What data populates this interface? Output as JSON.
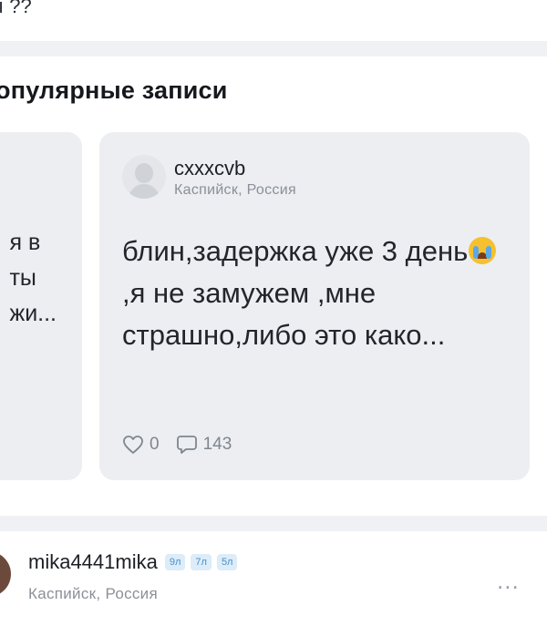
{
  "top_fragment": "ı ??",
  "section": {
    "title": "опулярные записи"
  },
  "left_card": {
    "lines": [
      "я в",
      "ты",
      "жи..."
    ]
  },
  "post": {
    "username": "cxxxcvb",
    "location": "Каспийск, Россия",
    "text_part1": "блин,задержка уже 3 день",
    "emoji": "loudly-crying-face",
    "text_part2": ",я не замужем ,мне страшно,либо это како...",
    "likes": "0",
    "comments": "143"
  },
  "next_post": {
    "username": "mika4441mika",
    "badges": [
      "9л",
      "7л",
      "5л"
    ],
    "location": "Каспийск, Россия",
    "more": "..."
  },
  "colors": {
    "card_bg": "#eceef1",
    "divider": "#f0f1f4",
    "muted": "#8a9099",
    "badge_bg": "#dcecf8",
    "badge_text": "#4a90c8"
  }
}
